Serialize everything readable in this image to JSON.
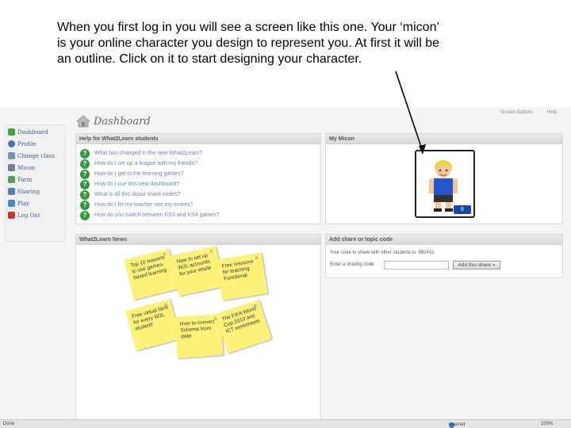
{
  "caption": {
    "line1": "When you first log in you will see a screen like this one. Your ‘micon’",
    "line2": "is your online character you design to represent you. At first it will be",
    "line3": "an outline. Click on it to start designing your character."
  },
  "header": {
    "title": "Dashboard",
    "screen_options": "Screen Options",
    "help": "Help"
  },
  "sidebar": {
    "items": [
      {
        "label": "Dashboard",
        "color": "#4a9c43"
      },
      {
        "label": "Profile",
        "color": "#4b6fb0"
      },
      {
        "label": "Change class",
        "color": "#7a8fb8"
      },
      {
        "label": "Micon",
        "color": "#6d7f9b"
      },
      {
        "label": "Farm",
        "color": "#5a9f51"
      },
      {
        "label": "Sharing",
        "color": "#5b7bb5"
      },
      {
        "label": "Play",
        "color": "#4f86c9"
      },
      {
        "label": "Log Out",
        "color": "#c8392e"
      }
    ]
  },
  "help_panel": {
    "title": "Help for What2Learn students",
    "links": [
      "What has changed in the new What2Learn?",
      "How do I set up a league with my friends?",
      "How do I get to the learning games?",
      "How do I use this new dashboard?",
      "What is all this about share codes?",
      "How do I let my teacher see my scores?",
      "How do you switch between KS3 and KS4 games?"
    ]
  },
  "micon_panel": {
    "title": "My Micon",
    "badge": "8"
  },
  "news_panel": {
    "title": "What2Learn News",
    "notes": [
      "Top 10 reasons to use games-based learning",
      "How to set up W2L accounts for your whole",
      "Free resource for teaching Functional",
      "Free virtual farm for every W2L student!",
      "How to convert Scheme from slide",
      "The FIFA World Cup 2010 and ICT worksheets"
    ]
  },
  "share_panel": {
    "title": "Add share or topic code",
    "code_text": "Your code to share with other students is: 882431",
    "enter_label": "Enter a sharing code:",
    "input_value": "",
    "button": "Add this share »"
  },
  "statusbar": {
    "done": "Done",
    "zone": "Internet",
    "zoom": "100%"
  },
  "colors": {
    "link": "#6f86b3",
    "badge": "#1b48a8",
    "note": "#fff27a",
    "help_icon": "#2f9a3a"
  }
}
